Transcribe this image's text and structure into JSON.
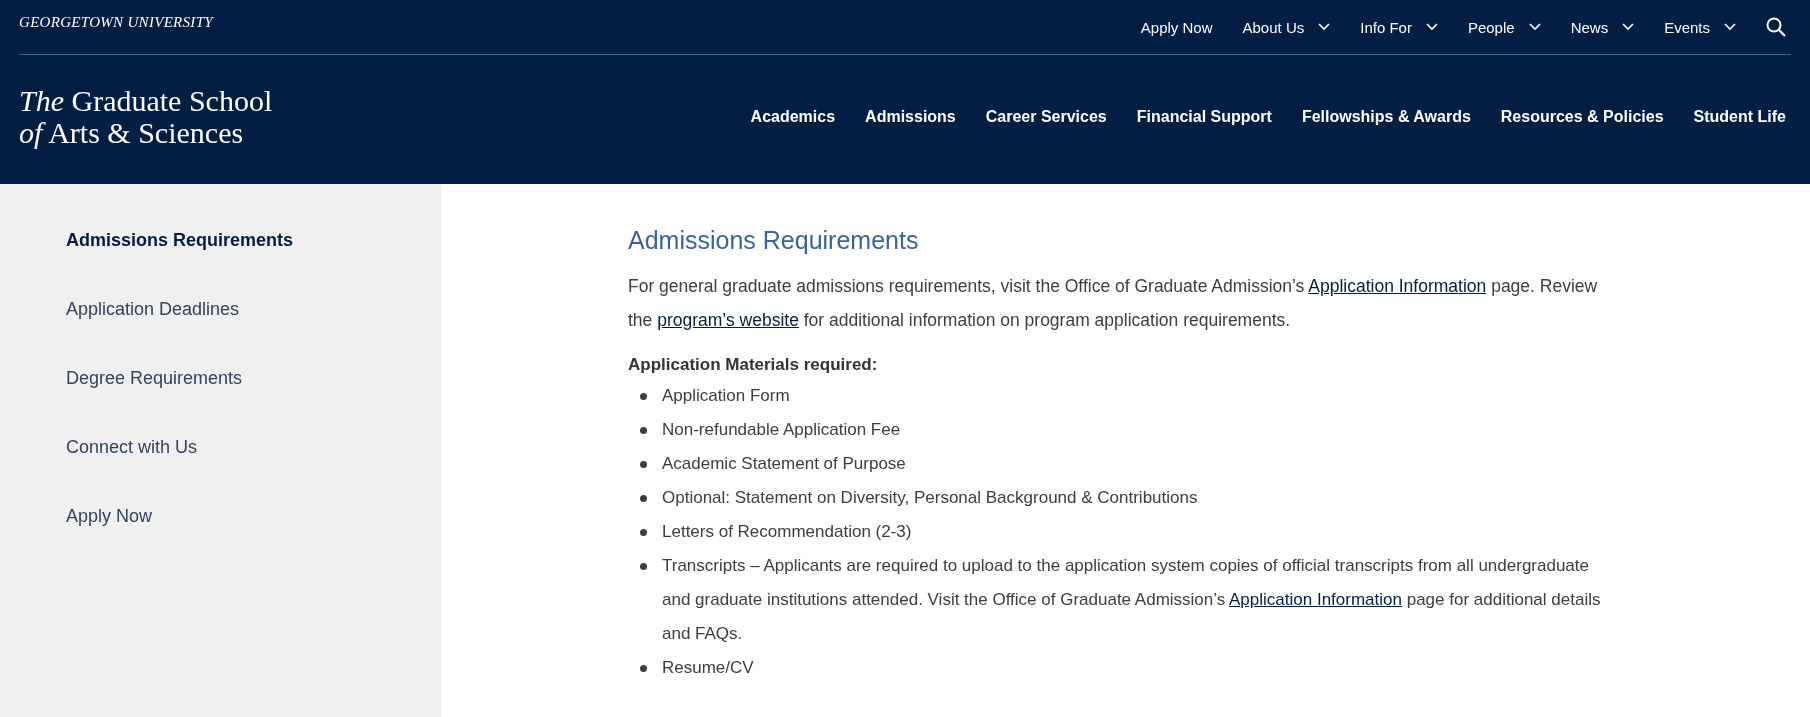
{
  "header": {
    "university": "GEORGETOWN UNIVERSITY",
    "utility_nav": [
      {
        "label": "Apply Now",
        "dropdown": false
      },
      {
        "label": "About Us",
        "dropdown": true
      },
      {
        "label": "Info For",
        "dropdown": true
      },
      {
        "label": "People",
        "dropdown": true
      },
      {
        "label": "News",
        "dropdown": true
      },
      {
        "label": "Events",
        "dropdown": true
      }
    ],
    "logo": {
      "line1_prefix": "The",
      "line1": "Graduate School",
      "line2_prefix": "of",
      "line2": "Arts & Sciences"
    },
    "main_nav": [
      "Academics",
      "Admissions",
      "Career Services",
      "Financial Support",
      "Fellowships & Awards",
      "Resources & Policies",
      "Student Life"
    ]
  },
  "sidebar": {
    "items": [
      {
        "label": "Admissions Requirements",
        "selected": true
      },
      {
        "label": "Application Deadlines",
        "selected": false
      },
      {
        "label": "Degree Requirements",
        "selected": false
      },
      {
        "label": "Connect with Us",
        "selected": false
      },
      {
        "label": "Apply Now",
        "selected": false
      }
    ]
  },
  "content": {
    "title": "Admissions Requirements",
    "intro": [
      {
        "kind": "text",
        "text": "For general graduate admissions requirements, visit the Office of Graduate Admission’s "
      },
      {
        "kind": "link",
        "text": "Application Information"
      },
      {
        "kind": "text",
        "text": " page. Review the "
      },
      {
        "kind": "link",
        "text": "program’s website"
      },
      {
        "kind": "text",
        "text": " for additional information on program application requirements."
      }
    ],
    "materials_heading": "Application Materials required:",
    "materials": [
      [
        {
          "kind": "text",
          "text": "Application Form"
        }
      ],
      [
        {
          "kind": "text",
          "text": "Non-refundable Application Fee"
        }
      ],
      [
        {
          "kind": "text",
          "text": "Academic Statement of Purpose"
        }
      ],
      [
        {
          "kind": "text",
          "text": "Optional: Statement on Diversity, Personal Background & Contributions"
        }
      ],
      [
        {
          "kind": "text",
          "text": "Letters of Recommendation (2-3)"
        }
      ],
      [
        {
          "kind": "text",
          "text": "Transcripts – Applicants are required to upload to the application system copies of official transcripts from all undergraduate and graduate institutions attended. Visit the Office of Graduate Admission’s "
        },
        {
          "kind": "link",
          "text": "Application Information"
        },
        {
          "kind": "text",
          "text": " page for additional details and FAQs."
        }
      ],
      [
        {
          "kind": "text",
          "text": "Resume/CV"
        }
      ]
    ]
  }
}
